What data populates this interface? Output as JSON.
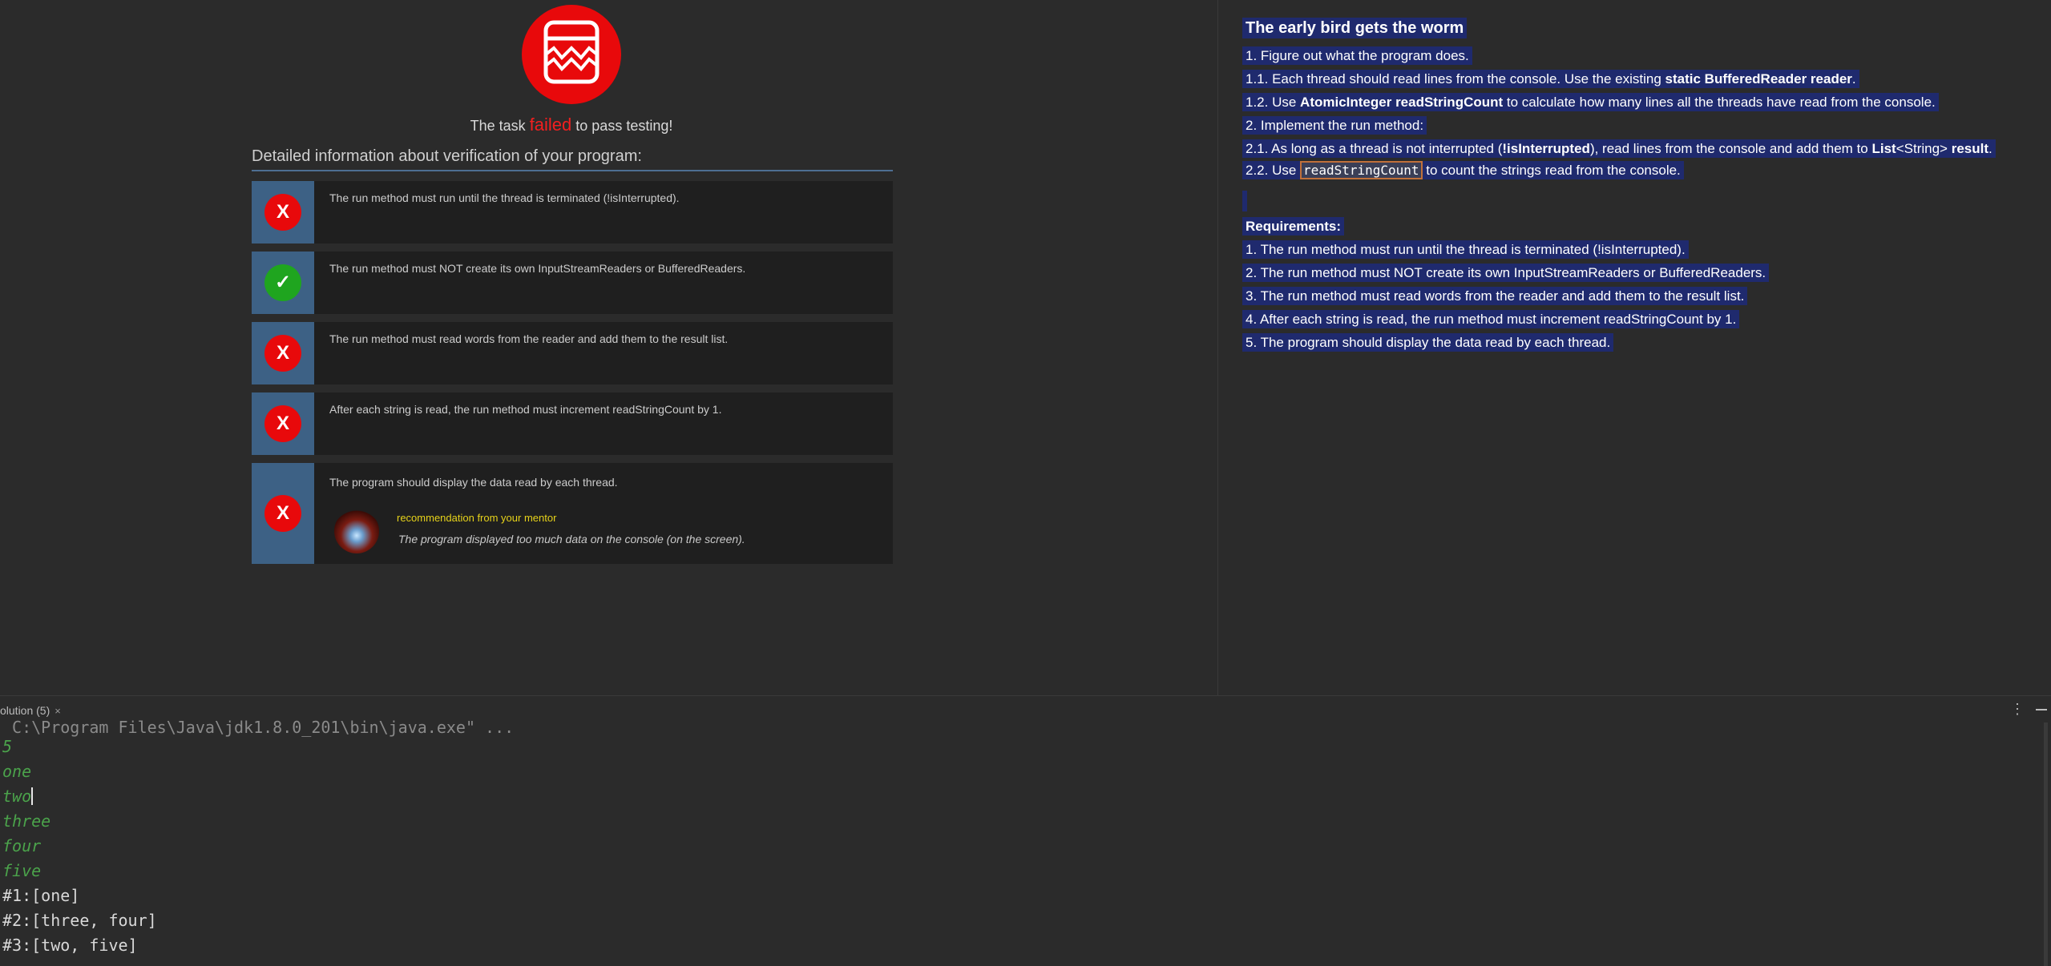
{
  "verification": {
    "status_prefix": "The task",
    "status_word": "failed",
    "status_suffix": "to pass testing!",
    "details_heading": "Detailed information about verification of your program:",
    "checks": [
      {
        "result": "fail",
        "symbol": "X",
        "text": "The run method must run until the thread is terminated (!isInterrupted)."
      },
      {
        "result": "pass",
        "symbol": "✓",
        "text": "The run method must NOT create its own InputStreamReaders or BufferedReaders."
      },
      {
        "result": "fail",
        "symbol": "X",
        "text": "The run method must read words from the reader and add them to the result list."
      },
      {
        "result": "fail",
        "symbol": "X",
        "text": "After each string is read, the run method must increment readStringCount by 1."
      },
      {
        "result": "fail",
        "symbol": "X",
        "text": "The program should display the data read by each thread."
      }
    ],
    "mentor": {
      "title": "recommendation from your mentor",
      "note": "The program displayed too much data on the console (on the screen)."
    }
  },
  "description": {
    "title": "The early bird gets the worm",
    "l1": "1. Figure out what the program does.",
    "l11_a": "1.1. Each thread should read lines from the console. Use the existing ",
    "l11_b": "static BufferedReader reader",
    "l11_c": ".",
    "l12_a": "1.2. Use ",
    "l12_b": "AtomicInteger readStringCount",
    "l12_c": " to calculate how many lines all the threads have read from the console.",
    "l2": "2. Implement the run method:",
    "l21_a": "2.1. As long as a thread is not interrupted (",
    "l21_b": "!isInterrupted",
    "l21_c": "), read lines from the console and add them to ",
    "l21_d": "List",
    "l21_e": "<String> ",
    "l21_f": "result",
    "l21_g": ".",
    "l22_a": "2.2. Use ",
    "l22_code": "readStringCount",
    "l22_c": " to count the strings read from the console.",
    "req_title": "Requirements:",
    "requirements": [
      "1. The run method must run until the thread is terminated (!isInterrupted).",
      "2. The run method must NOT create its own InputStreamReaders or BufferedReaders.",
      "3. The run method must read words from the reader and add them to the result list.",
      "4. After each string is read, the run method must increment readStringCount by 1.",
      "5. The program should display the data read by each thread."
    ]
  },
  "run_window": {
    "tab_label": "olution (5)",
    "close_symbol": "×",
    "more_symbol": "⋮",
    "console": [
      {
        "kind": "cmd",
        "text": " C:\\Program Files\\Java\\jdk1.8.0_201\\bin\\java.exe\" ..."
      },
      {
        "kind": "in",
        "text": "5"
      },
      {
        "kind": "in",
        "text": "one"
      },
      {
        "kind": "in",
        "text": "two"
      },
      {
        "kind": "in",
        "text": "three"
      },
      {
        "kind": "in",
        "text": "four"
      },
      {
        "kind": "in",
        "text": "five"
      },
      {
        "kind": "out",
        "text": "#1:[one]"
      },
      {
        "kind": "out",
        "text": "#2:[three, four]"
      },
      {
        "kind": "out",
        "text": "#3:[two, five]"
      }
    ]
  },
  "colors": {
    "background": "#2b2b2b",
    "fail": "#e8090b",
    "pass": "#1fa51f",
    "selection": "#1f2a6e",
    "console_input": "#4ba34b"
  }
}
